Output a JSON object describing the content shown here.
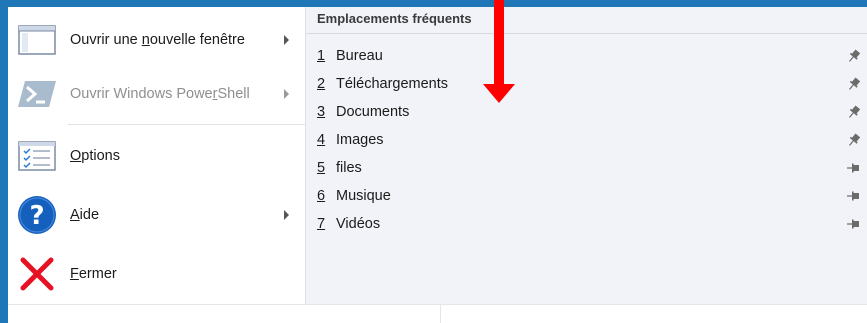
{
  "menu": {
    "items": [
      {
        "pre": "Ouvrir une ",
        "key": "n",
        "post": "ouvelle fenêtre",
        "has_submenu": true,
        "enabled": true,
        "icon": "new-window-icon"
      },
      {
        "pre": "Ouvrir Windows Powe",
        "key": "r",
        "post": "Shell",
        "has_submenu": true,
        "enabled": false,
        "icon": "powershell-icon"
      },
      {
        "pre": "",
        "key": "O",
        "post": "ptions",
        "has_submenu": false,
        "enabled": true,
        "icon": "options-icon"
      },
      {
        "pre": "",
        "key": "A",
        "post": "ide",
        "has_submenu": true,
        "enabled": true,
        "icon": "help-icon"
      },
      {
        "pre": "",
        "key": "F",
        "post": "ermer",
        "has_submenu": false,
        "enabled": true,
        "icon": "close-icon"
      }
    ]
  },
  "recent": {
    "title": "Emplacements fréquents",
    "items": [
      {
        "num": "1",
        "name": "Bureau",
        "pinned": true,
        "icon": "pinned-icon"
      },
      {
        "num": "2",
        "name": "Téléchargements",
        "pinned": true,
        "icon": "pinned-icon"
      },
      {
        "num": "3",
        "name": "Documents",
        "pinned": true,
        "icon": "pinned-icon"
      },
      {
        "num": "4",
        "name": "Images",
        "pinned": true,
        "icon": "pinned-icon"
      },
      {
        "num": "5",
        "name": "files",
        "pinned": false,
        "icon": "unpinned-icon"
      },
      {
        "num": "6",
        "name": "Musique",
        "pinned": false,
        "icon": "unpinned-icon"
      },
      {
        "num": "7",
        "name": "Vidéos",
        "pinned": false,
        "icon": "unpinned-icon"
      }
    ]
  },
  "colors": {
    "window_accent": "#1f77b8",
    "annotation_arrow": "#ff0000",
    "help_blue": "#1560bd",
    "close_red": "#e81123"
  }
}
